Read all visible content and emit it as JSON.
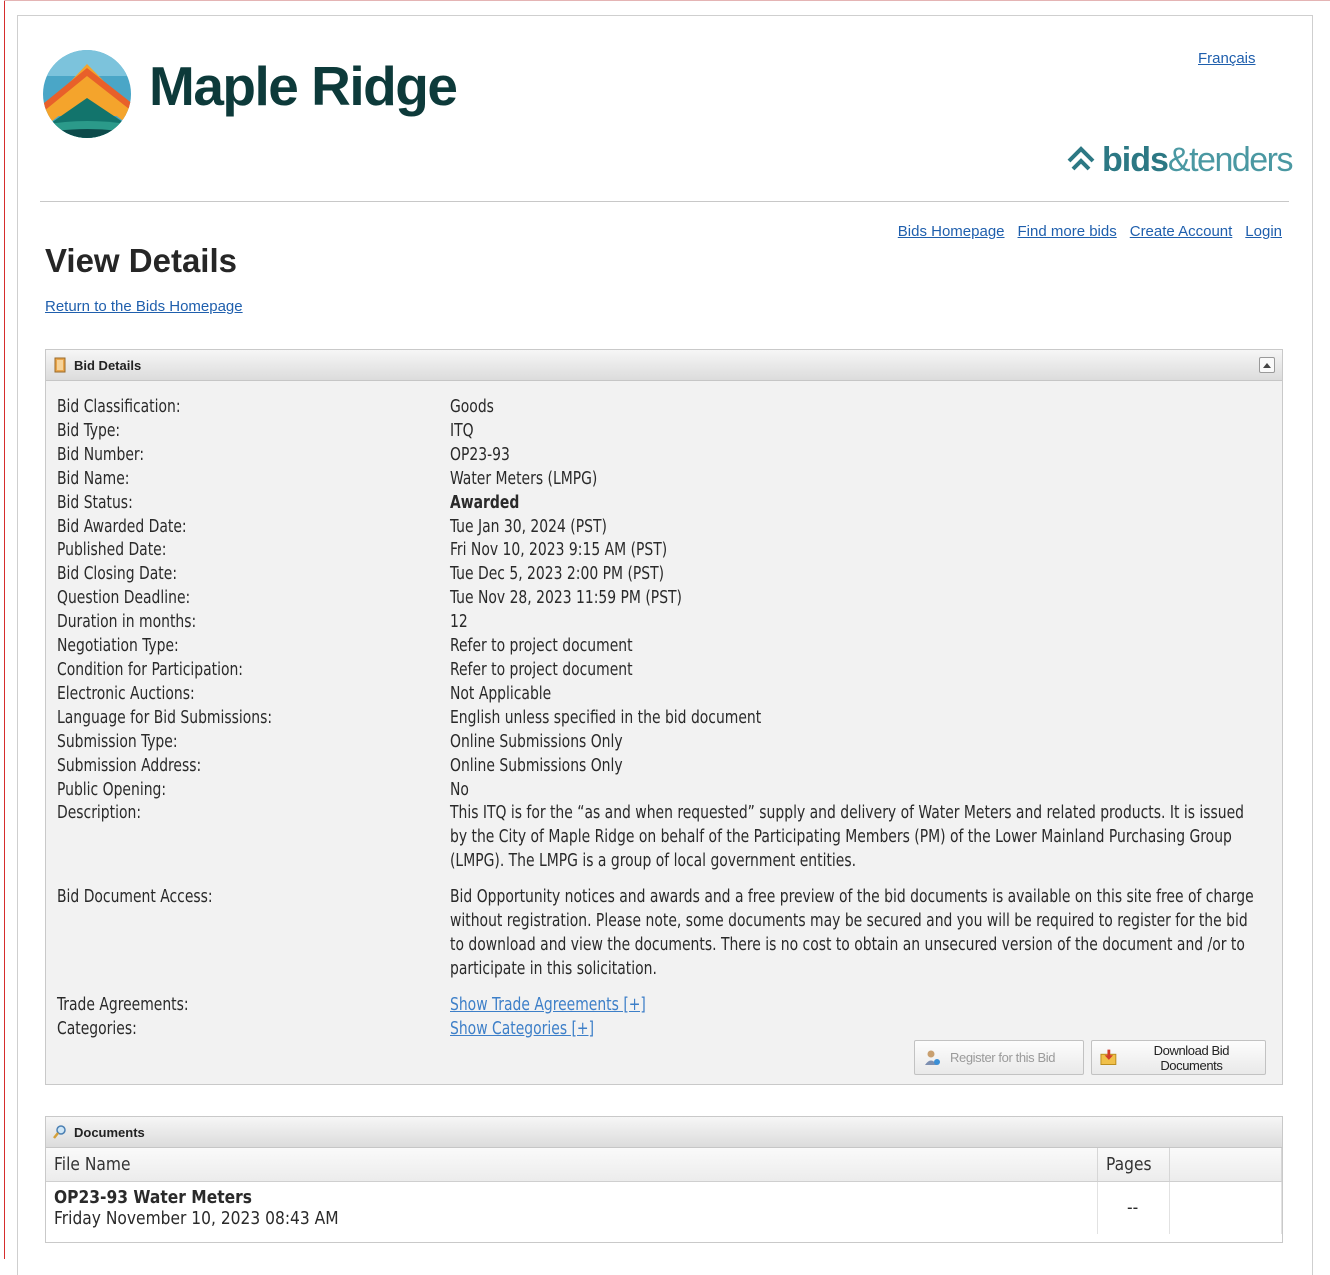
{
  "header": {
    "logo_text": "Maple Ridge",
    "language_link": "Français",
    "bt_logo_bids": "bids",
    "bt_logo_tenders": "&tenders"
  },
  "nav": {
    "bids_homepage": "Bids Homepage",
    "find_more_bids": "Find more bids",
    "create_account": "Create Account",
    "login": "Login"
  },
  "page": {
    "title": "View Details",
    "return_link": "Return to the Bids Homepage"
  },
  "bid_panel": {
    "title": "Bid Details",
    "rows": [
      {
        "label": "Bid Classification:",
        "value": "Goods"
      },
      {
        "label": "Bid Type:",
        "value": "ITQ"
      },
      {
        "label": "Bid Number:",
        "value": "OP23-93"
      },
      {
        "label": "Bid Name:",
        "value": "Water Meters (LMPG)"
      },
      {
        "label": "Bid Status:",
        "value": "Awarded"
      },
      {
        "label": "Bid Awarded Date:",
        "value": "Tue Jan 30, 2024 (PST)"
      },
      {
        "label": "Published Date:",
        "value": "Fri Nov 10, 2023 9:15 AM (PST)"
      },
      {
        "label": "Bid Closing Date:",
        "value": "Tue Dec 5, 2023 2:00 PM (PST)"
      },
      {
        "label": "Question Deadline:",
        "value": "Tue Nov 28, 2023 11:59 PM (PST)"
      },
      {
        "label": "Duration in months:",
        "value": "12"
      },
      {
        "label": "Negotiation Type:",
        "value": "Refer to project document"
      },
      {
        "label": "Condition for Participation:",
        "value": "Refer to project document"
      },
      {
        "label": "Electronic Auctions:",
        "value": "Not Applicable"
      },
      {
        "label": "Language for Bid Submissions:",
        "value": "English unless specified in the bid document"
      },
      {
        "label": "Submission Type:",
        "value": "Online Submissions Only"
      },
      {
        "label": "Submission Address:",
        "value": "Online Submissions Only"
      },
      {
        "label": "Public Opening:",
        "value": "No"
      },
      {
        "label": "Description:",
        "value": "This ITQ is for the “as and when requested” supply and delivery of Water Meters and related products. It is issued by the City of Maple Ridge on behalf of the Participating Members (PM) of the Lower Mainland Purchasing Group (LMPG).  The LMPG is a group of local government entities."
      },
      {
        "label": "Bid Document Access:",
        "value": "Bid Opportunity notices and awards and a free preview of the bid documents is available on this site free of charge without registration. Please note, some documents may be secured and you will be required to register for the bid to download and view the documents. There is no cost to obtain an unsecured version of the document and /or to participate in this solicitation."
      },
      {
        "label": "Trade Agreements:",
        "value": "Show Trade Agreements [+]"
      },
      {
        "label": "Categories:",
        "value": "Show Categories [+]"
      }
    ],
    "register_button": "Register for this Bid",
    "download_button": "Download Bid Documents"
  },
  "documents_panel": {
    "title": "Documents",
    "columns": [
      "File Name",
      "Pages"
    ],
    "rows": [
      {
        "name": "OP23-93 Water Meters",
        "date": "Friday November 10, 2023 08:43 AM",
        "pages": "--"
      }
    ]
  },
  "colors": {
    "link": "#1f5fad",
    "brand_dark": "#0d3a3a",
    "bt_teal": "#2c7884"
  }
}
